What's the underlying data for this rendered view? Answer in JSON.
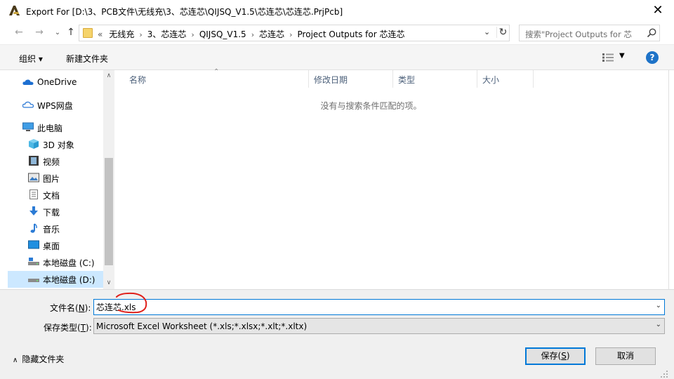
{
  "window": {
    "title": "Export For [D:\\3、PCB文件\\无线充\\3、芯连芯\\QIJSQ_V1.5\\芯连芯\\芯连芯.PrjPcb]",
    "close_glyph": "✕"
  },
  "nav_buttons": {
    "back": "←",
    "forward": "→",
    "recent": "⌄",
    "up": "↑"
  },
  "address": {
    "crumbs": [
      "«",
      "无线充",
      "3、芯连芯",
      "QIJSQ_V1.5",
      "芯连芯",
      "Project Outputs for 芯连芯"
    ],
    "refresh_glyph": "↻",
    "dropdown_glyph": "⌄"
  },
  "search": {
    "placeholder": "搜索\"Project Outputs for 芯"
  },
  "toolbar": {
    "organize_label": "组织 ▾",
    "new_folder_label": "新建文件夹",
    "help_label": "?"
  },
  "sidebar": {
    "items": [
      {
        "label": "OneDrive",
        "icon": "cloud-icon"
      },
      {
        "label": "WPS网盘",
        "icon": "cloud-outline-icon"
      },
      {
        "label": "此电脑",
        "icon": "computer-icon"
      },
      {
        "label": "3D 对象",
        "icon": "cube-icon"
      },
      {
        "label": "视频",
        "icon": "video-icon"
      },
      {
        "label": "图片",
        "icon": "picture-icon"
      },
      {
        "label": "文档",
        "icon": "document-icon"
      },
      {
        "label": "下载",
        "icon": "download-icon"
      },
      {
        "label": "音乐",
        "icon": "music-icon"
      },
      {
        "label": "桌面",
        "icon": "desktop-icon"
      },
      {
        "label": "本地磁盘 (C:)",
        "icon": "drive-icon"
      },
      {
        "label": "本地磁盘 (D:)",
        "icon": "drive-icon"
      }
    ],
    "selected": "本地磁盘 (D:)"
  },
  "file_list": {
    "columns": [
      "名称",
      "修改日期",
      "类型",
      "大小"
    ],
    "sort_column": "名称",
    "empty_message": "没有与搜索条件匹配的项。"
  },
  "form": {
    "filename_label": "文件名(N):",
    "filename_label_plain": "文件名(",
    "filename_accel": "N",
    "filename_label_tail": "):",
    "filename_value": "芯连芯.xls",
    "filetype_label_plain": "保存类型(",
    "filetype_accel": "T",
    "filetype_label_tail": "):",
    "filetype_value": "Microsoft Excel Worksheet (*.xls;*.xlsx;*.xlt;*.xltx)"
  },
  "footer": {
    "hide_folders_label": "隐藏文件夹",
    "save_label_plain": "保存(",
    "save_accel": "S",
    "save_label_tail": ")",
    "cancel_label": "取消"
  },
  "colors": {
    "accent": "#0078d7",
    "selection": "#cce8ff",
    "annotation": "#e0201b"
  }
}
